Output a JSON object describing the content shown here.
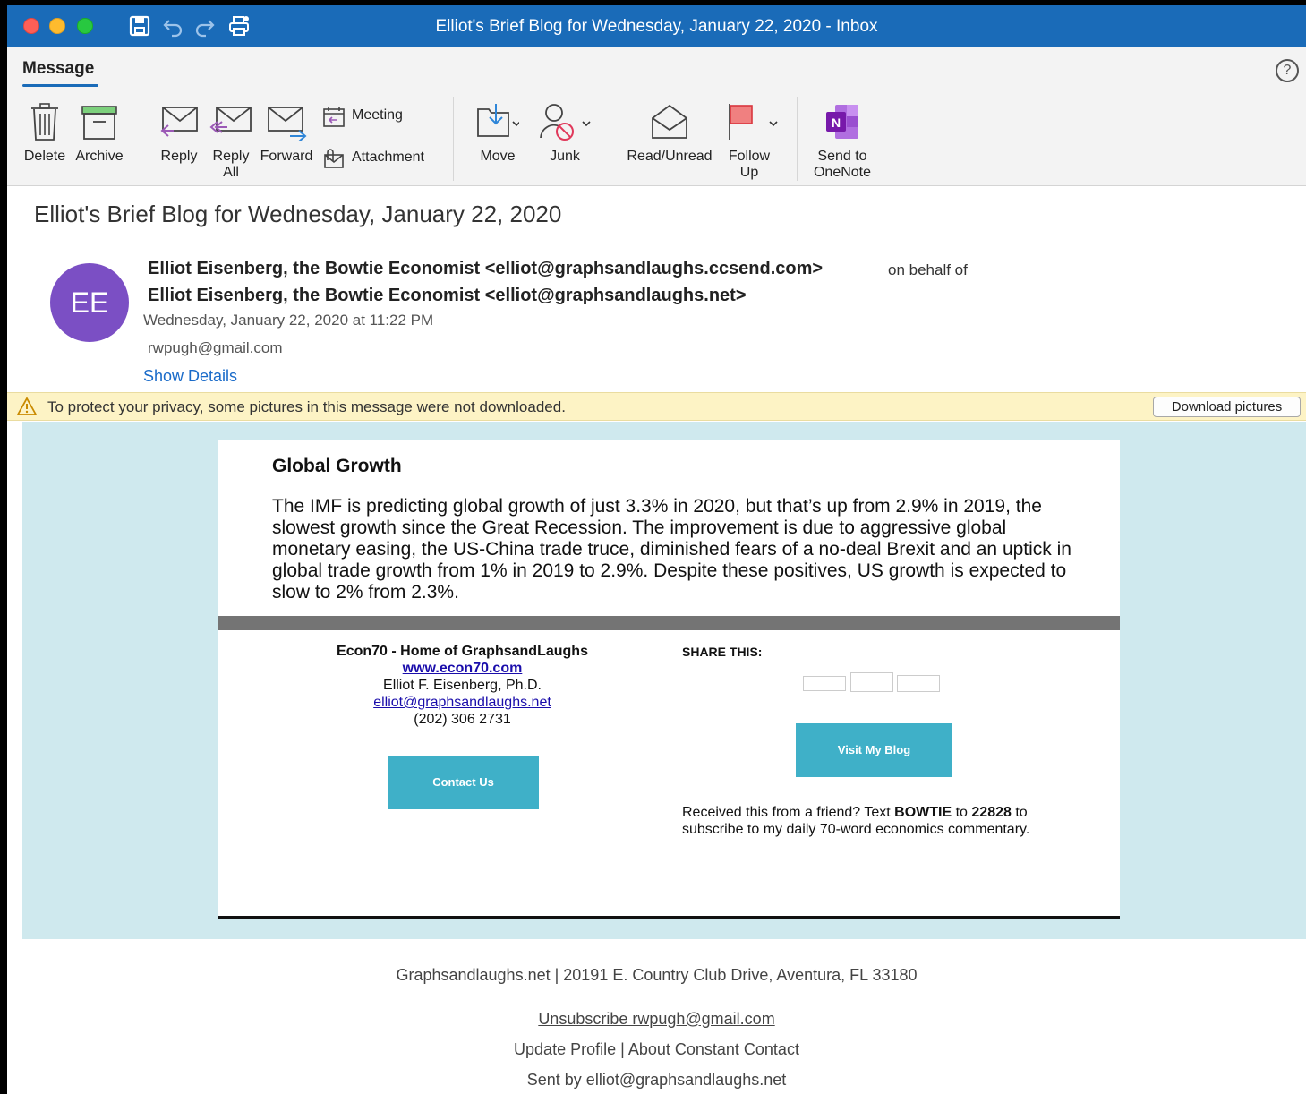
{
  "window": {
    "title": "Elliot's Brief Blog for Wednesday, January 22, 2020 - Inbox"
  },
  "ribbon": {
    "tab": "Message",
    "buttons": {
      "delete": "Delete",
      "archive": "Archive",
      "reply": "Reply",
      "reply_all_1": "Reply",
      "reply_all_2": "All",
      "forward": "Forward",
      "meeting": "Meeting",
      "attachment": "Attachment",
      "move": "Move",
      "junk": "Junk",
      "read_unread": "Read/Unread",
      "follow_up_1": "Follow",
      "follow_up_2": "Up",
      "onenote_1": "Send to",
      "onenote_2": "OneNote"
    },
    "help": "?"
  },
  "message": {
    "subject": "Elliot's Brief Blog for Wednesday, January 22, 2020",
    "avatar_initials": "EE",
    "from_sender": "Elliot Eisenberg, the Bowtie Economist <elliot@graphsandlaughs.ccsend.com>",
    "on_behalf_of": "on behalf of",
    "from_actual": "Elliot Eisenberg, the Bowtie Economist <elliot@graphsandlaughs.net>",
    "date": "Wednesday, January 22, 2020 at 11:22 PM",
    "to": "rwpugh@gmail.com",
    "show_details": "Show Details"
  },
  "privacy_bar": {
    "text": "To protect your privacy, some pictures in this message were not downloaded.",
    "button": "Download pictures"
  },
  "body": {
    "section_title": "Global Growth",
    "paragraph": "The IMF is predicting global growth of just 3.3% in 2020, but that’s up from 2.9% in 2019, the slowest growth since the Great Recession. The improvement is due to aggressive global monetary easing, the US-China trade truce, diminished fears of a no-deal Brexit and an uptick in global trade growth from 1% in 2019 to 2.9%. Despite these positives, US growth is expected to slow to 2% from 2.3%.",
    "footer_left": {
      "org": "Econ70 - Home of GraphsandLaughs",
      "website": "www.econ70.com",
      "name": "Elliot F. Eisenberg, Ph.D.",
      "email": "elliot@graphsandlaughs.net",
      "phone": "(202) 306 2731",
      "contact_button": "Contact Us"
    },
    "footer_right": {
      "share_title": "SHARE THIS:",
      "visit_button": "Visit My Blog",
      "received_1": "Received this from a friend? Text ",
      "received_bold1": "BOWTIE",
      "received_2": " to ",
      "received_bold2": "22828",
      "received_3": " to subscribe to my daily 70-word economics commentary."
    }
  },
  "footer": {
    "address": "Graphsandlaughs.net | 20191 E. Country Club Drive, Aventura, FL 33180",
    "unsubscribe": "Unsubscribe rwpugh@gmail.com",
    "update_profile": "Update Profile",
    "separator": "|",
    "about": "About Constant Contact",
    "sent_by": "Sent by elliot@graphsandlaughs.net"
  }
}
